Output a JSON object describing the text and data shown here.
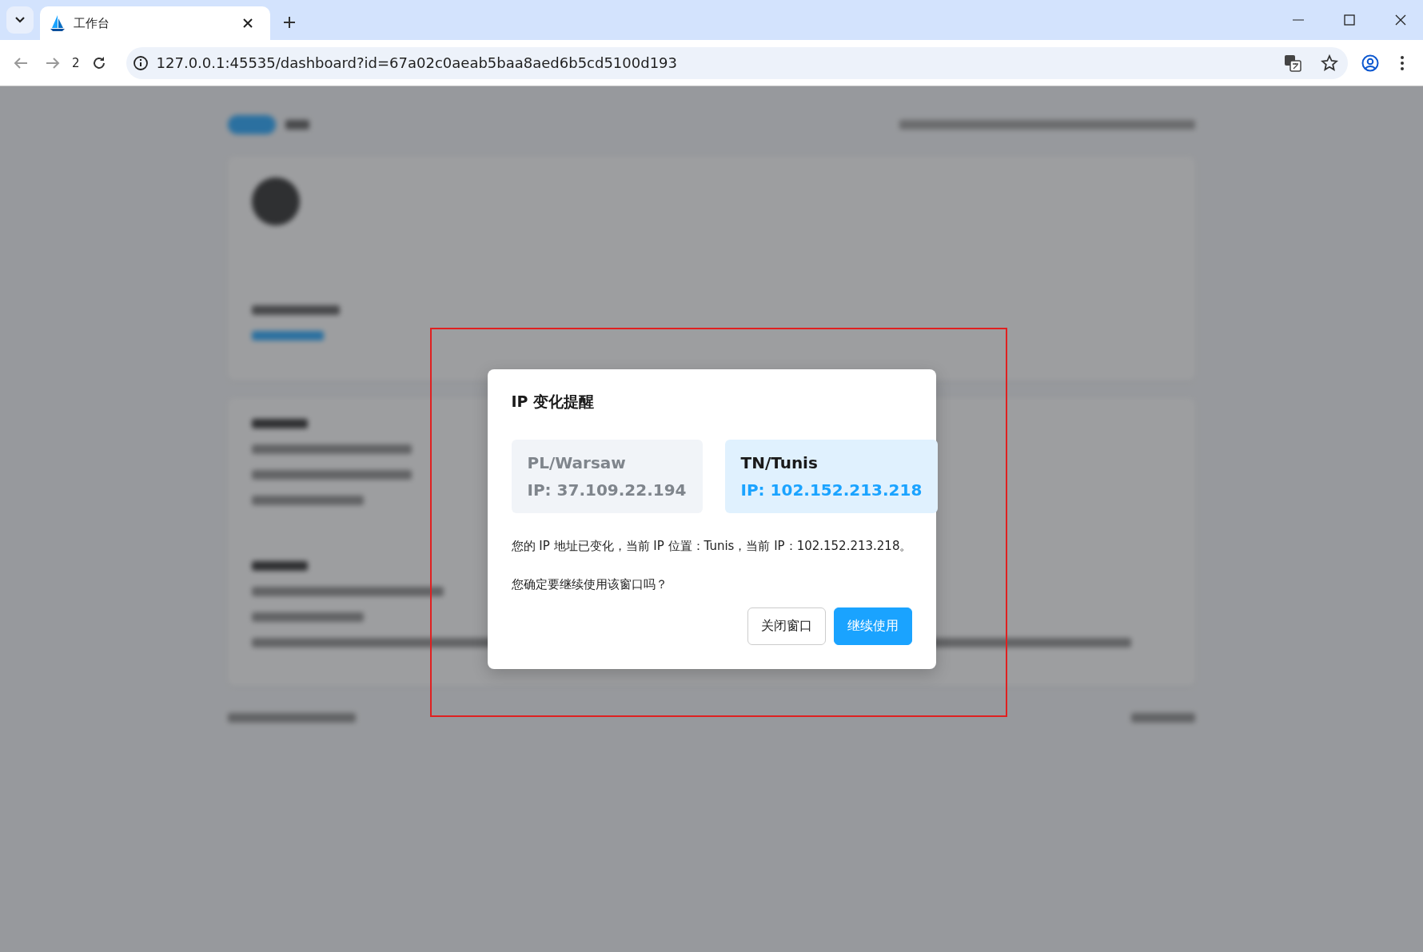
{
  "browser": {
    "tab": {
      "title": "工作台"
    },
    "nav_label": "2",
    "address": "127.0.0.1:45535/dashboard?id=67a02c0aeab5baa8aed6b5cd5100d193"
  },
  "dialog": {
    "title": "IP 变化提醒",
    "previous": {
      "location": "PL/Warsaw",
      "ip": "IP: 37.109.22.194"
    },
    "current": {
      "location": "TN/Tunis",
      "ip": "IP: 102.152.213.218"
    },
    "message": "您的 IP 地址已变化，当前 IP 位置：Tunis，当前 IP：102.152.213.218。",
    "question": "您确定要继续使用该窗口吗？",
    "buttons": [
      {
        "label": "关闭窗口",
        "primary": false
      },
      {
        "label": "继续使用",
        "primary": true
      }
    ]
  }
}
